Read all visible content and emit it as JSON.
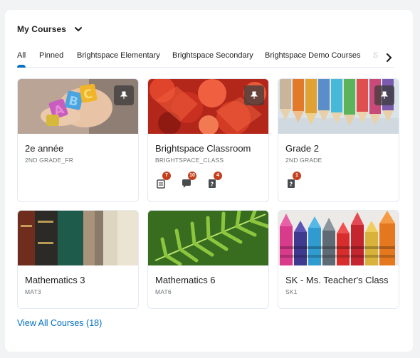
{
  "widget": {
    "title": "My Courses",
    "view_all": "View All Courses (18)"
  },
  "tabs": [
    {
      "label": "All",
      "active": true
    },
    {
      "label": "Pinned"
    },
    {
      "label": "Brightspace Elementary"
    },
    {
      "label": "Brightspace Secondary"
    },
    {
      "label": "Brightspace Demo Courses"
    },
    {
      "label": "S"
    }
  ],
  "courses": [
    {
      "title": "2e année",
      "code": "2ND GRADE_FR",
      "pinned": true,
      "image": "abc-blocks"
    },
    {
      "title": "Brightspace Classroom",
      "code": "BRIGHTSPACE_CLASS",
      "pinned": true,
      "image": "red-leaves",
      "alerts": [
        {
          "icon": "assignment-icon",
          "count": "7"
        },
        {
          "icon": "discussion-icon",
          "count": "10"
        },
        {
          "icon": "quiz-icon",
          "count": "4"
        }
      ]
    },
    {
      "title": "Grade 2",
      "code": "2ND GRADE",
      "pinned": true,
      "image": "colored-pencils",
      "alerts": [
        {
          "icon": "quiz-icon",
          "count": "1"
        }
      ]
    },
    {
      "title": "Mathematics 3",
      "code": "MAT3",
      "pinned": false,
      "image": "old-books"
    },
    {
      "title": "Mathematics 6",
      "code": "MAT6",
      "pinned": false,
      "image": "fern"
    },
    {
      "title": "SK - Ms. Teacher's Class",
      "code": "SK1",
      "pinned": false,
      "image": "crayons"
    }
  ],
  "colors": {
    "link": "#006fbf",
    "badge": "#c4401d",
    "text": "#202122"
  }
}
